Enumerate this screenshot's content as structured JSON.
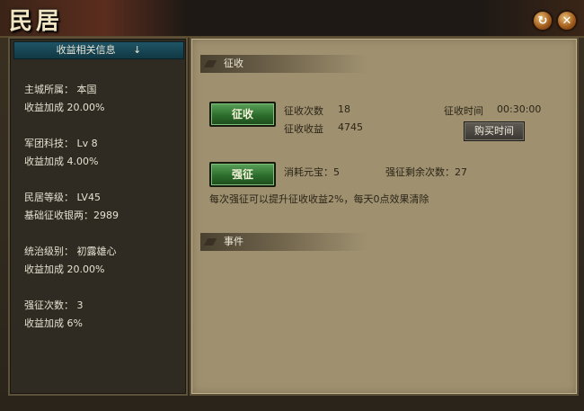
{
  "window": {
    "title": "民居",
    "refresh_icon": "refresh-icon",
    "close_icon": "close-icon",
    "refresh_glyph": "↻",
    "close_glyph": "✕"
  },
  "left_panel": {
    "header": "收益相关信息",
    "header_arrow": "↓",
    "lines": [
      "主城所属：  本国",
      "收益加成  20.00%",
      "军团科技：  Lv 8",
      "收益加成  4.00%",
      "民居等级：  LV45",
      "基础征收银两：2989",
      "统治级别：  初露雄心",
      "收益加成  20.00%",
      "强征次数：  3",
      "收益加成  6%"
    ]
  },
  "levy_section": {
    "title": "征收",
    "levy_button": "征收",
    "count_label": "征收次数",
    "count_value": "18",
    "income_label": "征收收益",
    "income_value": "4745",
    "time_label": "征收时间",
    "time_value": "00:30:00",
    "buy_time_button": "购买时间",
    "force_button": "强征",
    "cost_text": "消耗元宝：5",
    "remaining_text": "强征剩余次数：27",
    "note": "每次强征可以提升征收收益2%，每天0点效果清除"
  },
  "event_section": {
    "title": "事件"
  }
}
